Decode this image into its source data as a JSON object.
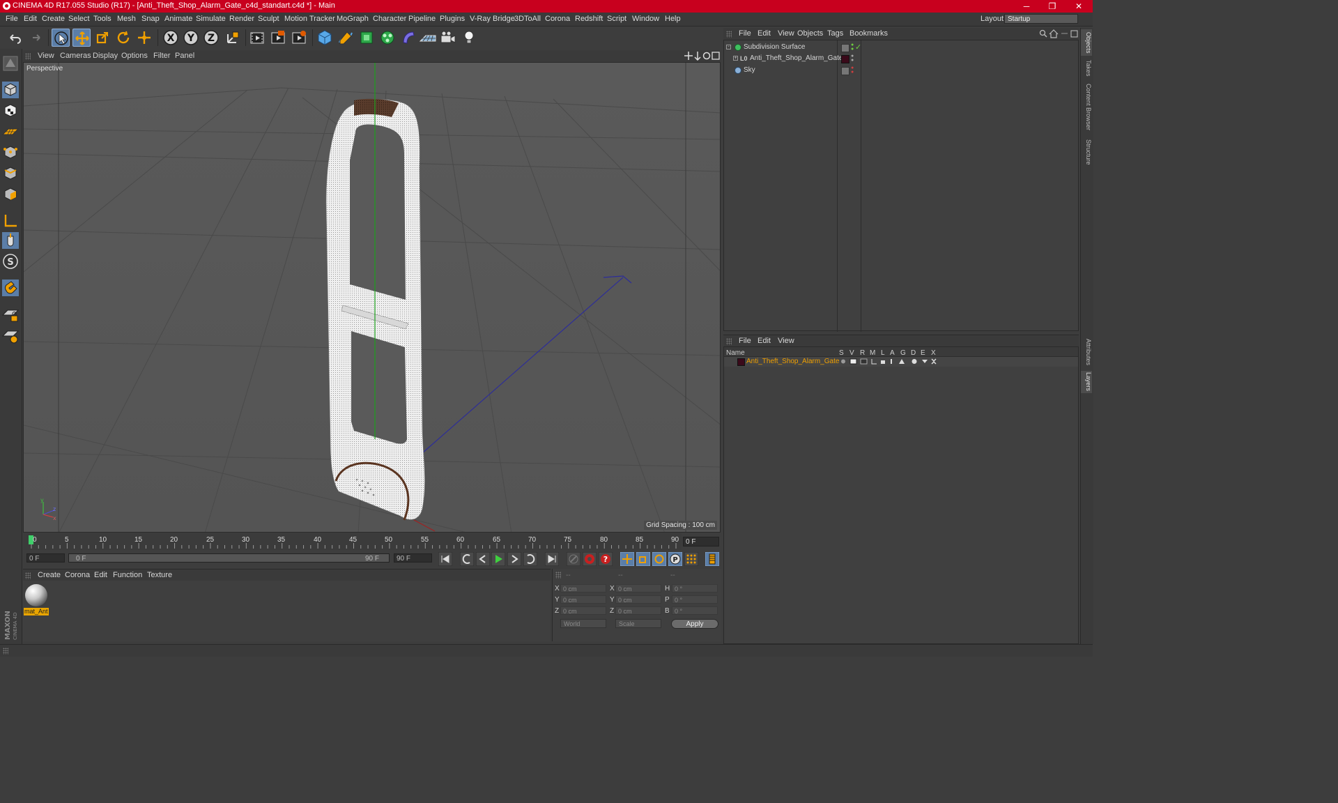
{
  "window": {
    "title": "CINEMA 4D R17.055 Studio (R17) - [Anti_Theft_Shop_Alarm_Gate_c4d_standart.c4d *] - Main",
    "minimize": "─",
    "maximize": "❐",
    "close": "✕"
  },
  "menu": [
    "File",
    "Edit",
    "Create",
    "Select",
    "Tools",
    "Mesh",
    "Snap",
    "Animate",
    "Simulate",
    "Render",
    "Sculpt",
    "Motion Tracker",
    "MoGraph",
    "Character",
    "Pipeline",
    "Plugins",
    "V-Ray Bridge",
    "3DToAll",
    "Corona",
    "Redshift",
    "Script",
    "Window",
    "Help"
  ],
  "layout": {
    "label": "Layout:",
    "value": "Startup"
  },
  "viewport": {
    "menu": [
      "View",
      "Cameras",
      "Display",
      "Options",
      "Filter",
      "Panel"
    ],
    "label": "Perspective",
    "grid_spacing": "Grid Spacing : 100 cm"
  },
  "timeline": {
    "ticks": [
      "0",
      "5",
      "10",
      "15",
      "20",
      "25",
      "30",
      "35",
      "40",
      "45",
      "50",
      "55",
      "60",
      "65",
      "70",
      "75",
      "80",
      "85",
      "90"
    ],
    "current_frame": "0 F"
  },
  "transport": {
    "start_field": "0 F",
    "slider_start": "0 F",
    "slider_end": "90 F",
    "end_field": "90 F"
  },
  "material_panel": {
    "menu": [
      "Create",
      "Corona",
      "Edit",
      "Function",
      "Texture"
    ],
    "materials": [
      {
        "name": "mat_Ant"
      }
    ]
  },
  "coordinates": {
    "headers": [
      "--",
      "--",
      "--"
    ],
    "rows": [
      {
        "a": "X",
        "a_val": "0 cm",
        "b": "X",
        "b_val": "0 cm",
        "c": "H",
        "c_val": "0 °"
      },
      {
        "a": "Y",
        "a_val": "0 cm",
        "b": "Y",
        "b_val": "0 cm",
        "c": "P",
        "c_val": "0 °"
      },
      {
        "a": "Z",
        "a_val": "0 cm",
        "b": "Z",
        "b_val": "0 cm",
        "c": "B",
        "c_val": "0 °"
      }
    ],
    "space": "World",
    "mode": "Scale",
    "apply": "Apply"
  },
  "object_manager": {
    "menu": [
      "File",
      "Edit",
      "View",
      "Objects",
      "Tags",
      "Bookmarks"
    ],
    "objects": [
      {
        "name": "Subdivision Surface"
      },
      {
        "name": "Anti_Theft_Shop_Alarm_Gate"
      },
      {
        "name": "Sky"
      }
    ]
  },
  "layer_manager": {
    "menu": [
      "File",
      "Edit",
      "View"
    ],
    "columns": [
      "Name",
      "S",
      "V",
      "R",
      "M",
      "L",
      "A",
      "G",
      "D",
      "E",
      "X"
    ],
    "layers": [
      {
        "name": "Anti_Theft_Shop_Alarm_Gate",
        "color": "#3a0a1a"
      }
    ]
  },
  "side_tabs": [
    "Objects",
    "Takes",
    "Content Browser",
    "Structure",
    "Attributes",
    "Layers"
  ],
  "colors": {
    "title_bar": "#c8001e",
    "accent": "#f0a000",
    "active_tool": "#5b7ea8"
  }
}
